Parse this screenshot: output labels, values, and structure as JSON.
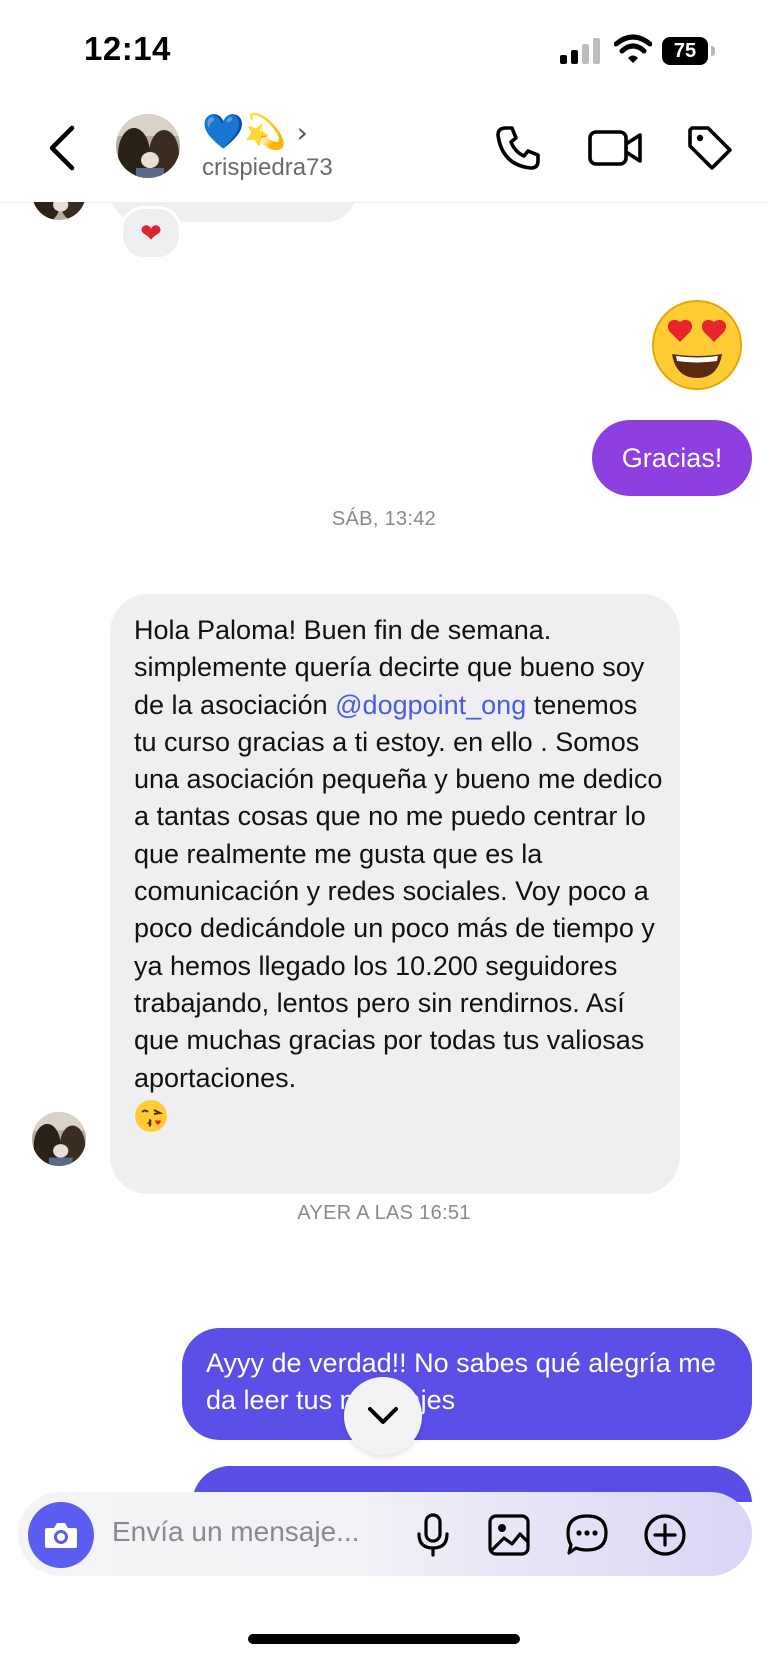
{
  "status": {
    "time": "12:14",
    "battery": "75"
  },
  "header": {
    "name_emojis": "💙💫",
    "username": "crispiedra73"
  },
  "chat": {
    "reaction": "❤",
    "outgoing_gracias": "Gracias!",
    "ts1": "SÁB, 13:42",
    "incoming": {
      "part1": "Hola Paloma! Buen fin de semana. simplemente quería decirte que bueno soy de la asociación ",
      "mention": "@dogpoint_ong",
      "part2": " tenemos tu curso gracias a ti estoy. en ello . Somos una asociación pequeña y bueno me dedico a tantas cosas que no me puedo centrar lo que realmente me gusta que es la comunicación y redes sociales. Voy poco a poco dedicándole un poco más de tiempo y ya hemos llegado los 10.200 seguidores trabajando, lentos pero sin rendirnos. Así que muchas gracias por todas tus valiosas aportaciones."
    },
    "ts2": "AYER A LAS 16:51",
    "outgoing_ayyy": "Ayyy de verdad!! No sabes qué alegría me da leer tus mensajes"
  },
  "composer": {
    "placeholder": "Envía un mensaje..."
  },
  "colors": {
    "accent_purple": "#8e3fe0",
    "accent_indigo": "#5b4fe8",
    "camera_button": "#5b5cf0"
  }
}
